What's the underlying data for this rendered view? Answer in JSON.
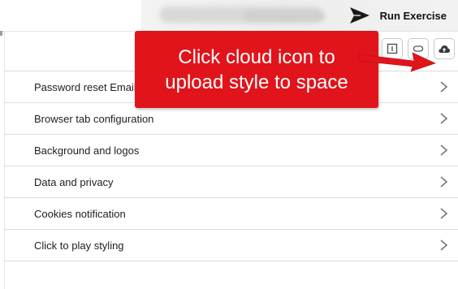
{
  "header": {
    "run_exercise_label": "Run Exercise",
    "run_icon": "paper-plane-icon"
  },
  "toolbar": {
    "icons": [
      "panel-icon",
      "toggle-icon",
      "cloud-upload-icon"
    ]
  },
  "list": {
    "items": [
      {
        "label": "Password reset Email",
        "icon": "chevron-right-icon"
      },
      {
        "label": "Browser tab configuration",
        "icon": "chevron-right-icon"
      },
      {
        "label": "Background and logos",
        "icon": "chevron-right-icon"
      },
      {
        "label": "Data and privacy",
        "icon": "chevron-right-icon"
      },
      {
        "label": "Cookies notification",
        "icon": "chevron-right-icon"
      },
      {
        "label": "Click to play styling",
        "icon": "chevron-right-icon"
      }
    ]
  },
  "callout": {
    "line1": "Click cloud icon to",
    "line2": "upload style to space"
  },
  "colors": {
    "callout_bg": "#e1141b",
    "divider": "#dcdcdc",
    "text": "#1e1e1e"
  }
}
